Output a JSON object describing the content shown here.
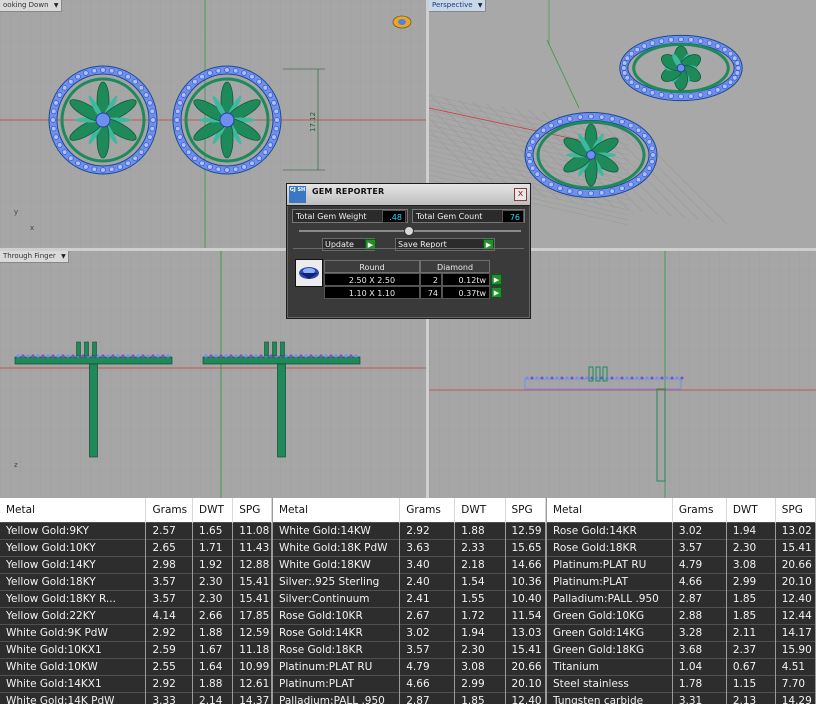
{
  "viewports": {
    "top": {
      "label": "ooking Down"
    },
    "perspective": {
      "label": "Perspective"
    },
    "front": {
      "label": "Through Finger"
    },
    "right": {
      "label": ""
    },
    "top_dimension": "17.12",
    "axis_y": "y",
    "axis_x": "x",
    "axis_z": "z"
  },
  "gem_reporter": {
    "title": "GEM REPORTER",
    "logo_text": "GJ SH",
    "close_label": "x",
    "total_weight_label": "Total Gem Weight",
    "total_weight_value": ".48",
    "total_count_label": "Total Gem Count",
    "total_count_value": "76",
    "update_label": "Update",
    "save_report_label": "Save Report",
    "go_glyph": "▶",
    "table_headers": [
      "Round",
      "Diamond"
    ],
    "rows": [
      {
        "size": "2.50 X 2.50",
        "count": "2",
        "weight": "0.12tw"
      },
      {
        "size": "1.10 X 1.10",
        "count": "74",
        "weight": "0.37tw"
      }
    ]
  },
  "metal_tables": {
    "headers": [
      "Metal",
      "Grams",
      "DWT",
      "SPG"
    ],
    "tables": [
      [
        [
          "Yellow Gold:9KY",
          "2.57",
          "1.65",
          "11.08"
        ],
        [
          "Yellow Gold:10KY",
          "2.65",
          "1.71",
          "11.43"
        ],
        [
          "Yellow Gold:14KY",
          "2.98",
          "1.92",
          "12.88"
        ],
        [
          "Yellow Gold:18KY",
          "3.57",
          "2.30",
          "15.41"
        ],
        [
          "Yellow Gold:18KY R...",
          "3.57",
          "2.30",
          "15.41"
        ],
        [
          "Yellow Gold:22KY",
          "4.14",
          "2.66",
          "17.85"
        ],
        [
          "White Gold:9K PdW",
          "2.92",
          "1.88",
          "12.59"
        ],
        [
          "White Gold:10KX1",
          "2.59",
          "1.67",
          "11.18"
        ],
        [
          "White Gold:10KW",
          "2.55",
          "1.64",
          "10.99"
        ],
        [
          "White Gold:14KX1",
          "2.92",
          "1.88",
          "12.61"
        ],
        [
          "White Gold:14K PdW",
          "3.33",
          "2.14",
          "14.37"
        ]
      ],
      [
        [
          "White Gold:14KW",
          "2.92",
          "1.88",
          "12.59"
        ],
        [
          "White Gold:18K PdW",
          "3.63",
          "2.33",
          "15.65"
        ],
        [
          "White Gold:18KW",
          "3.40",
          "2.18",
          "14.66"
        ],
        [
          "Silver:.925 Sterling",
          "2.40",
          "1.54",
          "10.36"
        ],
        [
          "Silver:Continuum",
          "2.41",
          "1.55",
          "10.40"
        ],
        [
          "Rose Gold:10KR",
          "2.67",
          "1.72",
          "11.54"
        ],
        [
          "Rose Gold:14KR",
          "3.02",
          "1.94",
          "13.03"
        ],
        [
          "Rose Gold:18KR",
          "3.57",
          "2.30",
          "15.41"
        ],
        [
          "Platinum:PLAT RU",
          "4.79",
          "3.08",
          "20.66"
        ],
        [
          "Platinum:PLAT",
          "4.66",
          "2.99",
          "20.10"
        ],
        [
          "Palladium:PALL .950",
          "2.87",
          "1.85",
          "12.40"
        ]
      ],
      [
        [
          "Rose Gold:14KR",
          "3.02",
          "1.94",
          "13.02"
        ],
        [
          "Rose Gold:18KR",
          "3.57",
          "2.30",
          "15.41"
        ],
        [
          "Platinum:PLAT RU",
          "4.79",
          "3.08",
          "20.66"
        ],
        [
          "Platinum:PLAT",
          "4.66",
          "2.99",
          "20.10"
        ],
        [
          "Palladium:PALL .950",
          "2.87",
          "1.85",
          "12.40"
        ],
        [
          "Green Gold:10KG",
          "2.88",
          "1.85",
          "12.44"
        ],
        [
          "Green Gold:14KG",
          "3.28",
          "2.11",
          "14.17"
        ],
        [
          "Green Gold:18KG",
          "3.68",
          "2.37",
          "15.90"
        ],
        [
          "Titanium",
          "1.04",
          "0.67",
          "4.51"
        ],
        [
          "Steel stainless",
          "1.78",
          "1.15",
          "7.70"
        ],
        [
          "Tungsten carbide",
          "3.31",
          "2.13",
          "14.29"
        ]
      ]
    ]
  },
  "colors": {
    "viewport_bg": "#a6a6a6",
    "model_green": "#1e8a5a",
    "gem_blue": "#6f8ff0",
    "gem_purple": "#7c4fd0",
    "axis_red": "#c83c3c",
    "axis_green": "#2e9a3a",
    "accent_cyan": "#2fd8ff"
  }
}
